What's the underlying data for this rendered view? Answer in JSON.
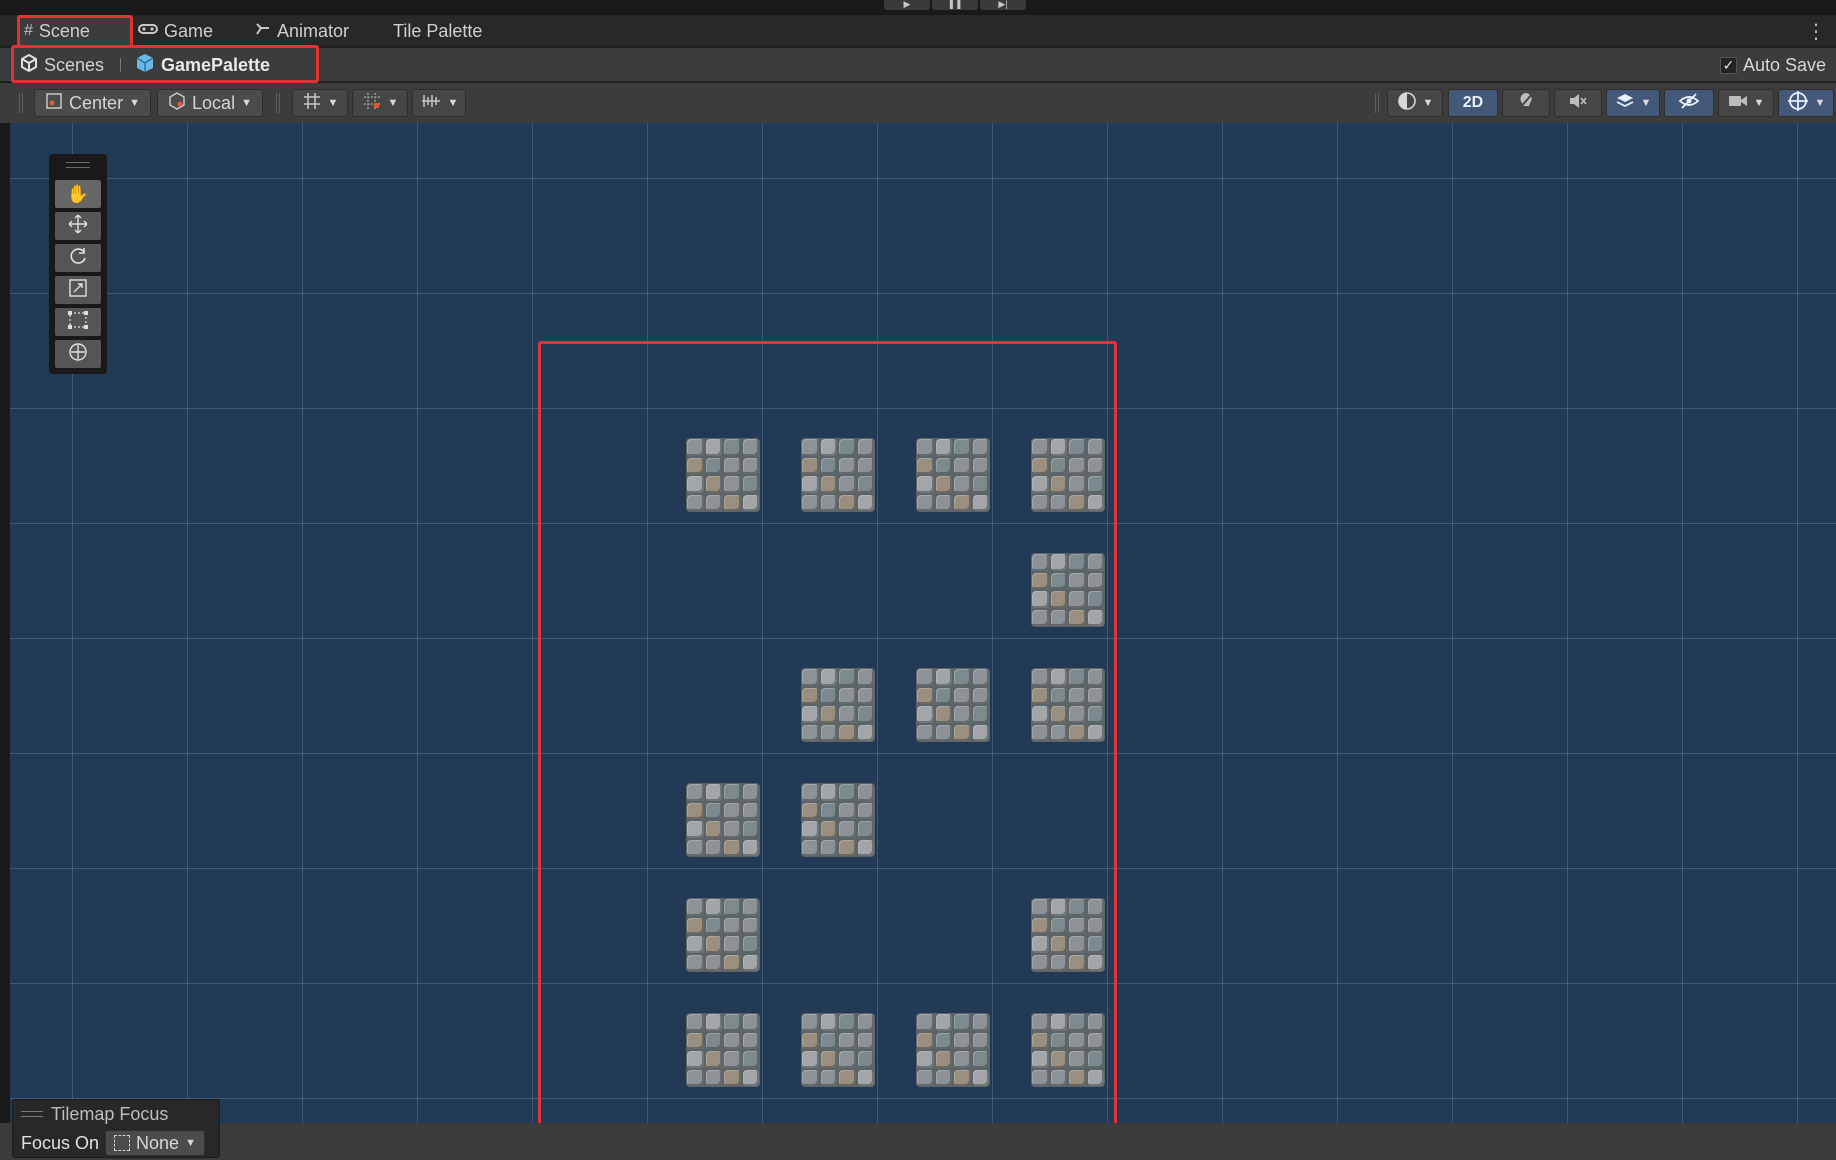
{
  "tabs": [
    {
      "label": "Scene",
      "icon": "grid-icon",
      "active": true
    },
    {
      "label": "Game",
      "icon": "gamepad-icon",
      "active": false
    },
    {
      "label": "Animator",
      "icon": "animator-icon",
      "active": false
    },
    {
      "label": "Tile Palette",
      "icon": "",
      "active": false
    }
  ],
  "breadcrumb": {
    "root": "Scenes",
    "current": "GamePalette"
  },
  "autosave": {
    "label": "Auto Save",
    "checked": true
  },
  "toolbar": {
    "pivot_label": "Center",
    "space_label": "Local",
    "mode_2d_label": "2D"
  },
  "tools": [
    "hand-tool",
    "move-tool",
    "rotate-tool",
    "scale-tool",
    "rect-tool",
    "transform-tool"
  ],
  "tiles": [
    [
      true,
      true,
      true,
      true
    ],
    [
      false,
      false,
      false,
      true
    ],
    [
      false,
      true,
      true,
      true
    ],
    [
      true,
      true,
      false,
      false
    ],
    [
      true,
      false,
      false,
      true
    ],
    [
      true,
      true,
      true,
      true
    ]
  ],
  "tilemap_focus": {
    "title": "Tilemap Focus",
    "focus_on_label": "Focus On",
    "value": "None"
  },
  "colors": {
    "scene_bg": "#223a55",
    "highlight": "#e03333",
    "accent_2d": "#44597a"
  }
}
